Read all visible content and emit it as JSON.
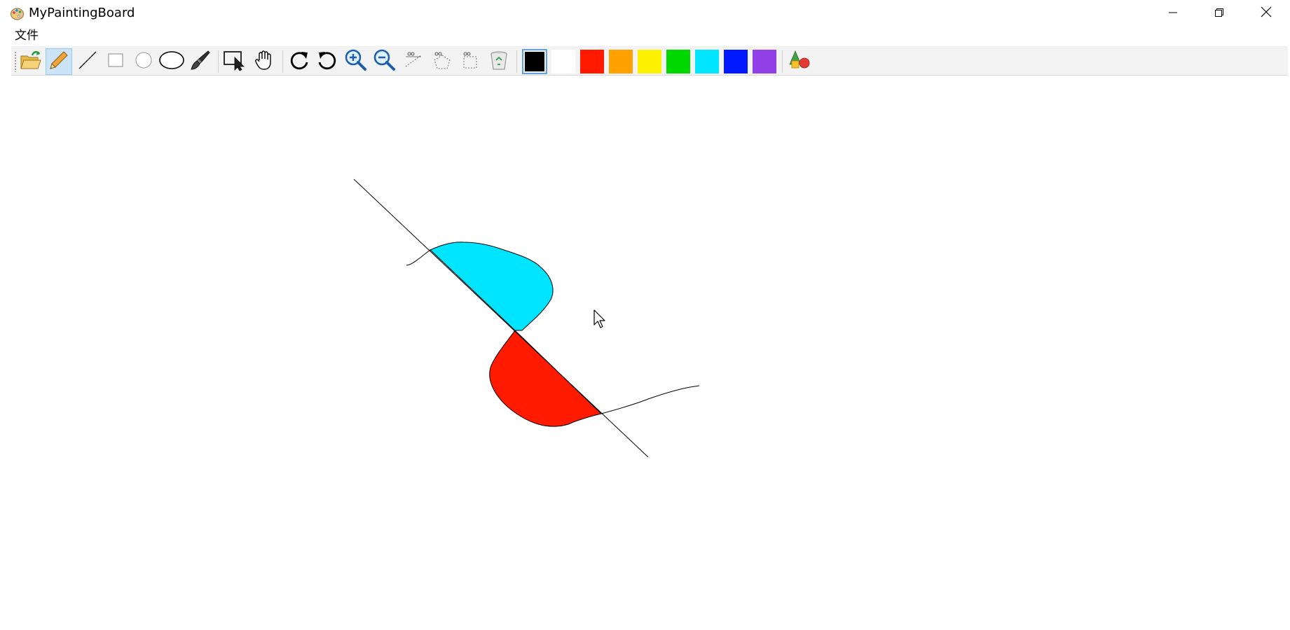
{
  "window": {
    "title": "MyPaintingBoard",
    "controls": [
      "minimize-icon",
      "restore-icon",
      "close-icon"
    ]
  },
  "menu": {
    "items": [
      {
        "label": "文件"
      }
    ]
  },
  "toolbar": {
    "tools": [
      {
        "name": "open-folder-icon",
        "active": false
      },
      {
        "name": "pencil-icon",
        "active": true
      },
      {
        "name": "line-icon",
        "active": false
      },
      {
        "name": "rectangle-icon",
        "active": false
      },
      {
        "name": "circle-icon",
        "active": false
      },
      {
        "name": "ellipse-icon",
        "active": false
      },
      {
        "name": "brush-icon",
        "active": false
      },
      {
        "name": "select-icon",
        "active": false
      },
      {
        "name": "hand-icon",
        "active": false
      },
      {
        "name": "redo-icon",
        "active": false
      },
      {
        "name": "undo-icon",
        "active": false
      },
      {
        "name": "zoom-in-icon",
        "active": false
      },
      {
        "name": "zoom-out-icon",
        "active": false
      },
      {
        "name": "cut-line-icon",
        "active": false
      },
      {
        "name": "cut-polygon-icon",
        "active": false
      },
      {
        "name": "cut-rect-icon",
        "active": false
      },
      {
        "name": "recycle-bin-icon",
        "active": false
      },
      {
        "name": "shapes-3d-icon",
        "active": false
      }
    ],
    "colors": [
      {
        "name": "black",
        "value": "#000000",
        "selected": true
      },
      {
        "name": "white",
        "value": "#ffffff",
        "selected": false
      },
      {
        "name": "red",
        "value": "#ff1a00",
        "selected": false
      },
      {
        "name": "orange",
        "value": "#ffa200",
        "selected": false
      },
      {
        "name": "yellow",
        "value": "#fff200",
        "selected": false
      },
      {
        "name": "green",
        "value": "#00d800",
        "selected": false
      },
      {
        "name": "cyan",
        "value": "#00e5ff",
        "selected": false
      },
      {
        "name": "blue",
        "value": "#0019ff",
        "selected": false
      },
      {
        "name": "purple",
        "value": "#9040e6",
        "selected": false
      }
    ]
  },
  "canvas": {
    "shapes": [
      {
        "name": "diagonal-line",
        "type": "line",
        "stroke": "#000000"
      },
      {
        "name": "cyan-filled-shape",
        "type": "freehand-fill",
        "fill": "#00e5ff"
      },
      {
        "name": "red-filled-shape",
        "type": "freehand-fill",
        "fill": "#ff1a00"
      },
      {
        "name": "freehand-stroke-left",
        "type": "freehand",
        "stroke": "#000000"
      },
      {
        "name": "freehand-stroke-right",
        "type": "freehand",
        "stroke": "#000000"
      }
    ]
  }
}
